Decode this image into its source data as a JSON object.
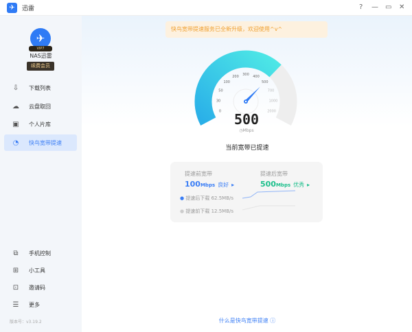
{
  "app": {
    "title": "迅雷",
    "logo_icon": "bird-logo-icon"
  },
  "window": {
    "help": "?",
    "minimize": "—",
    "maximize": "▭",
    "close": "✕"
  },
  "user": {
    "name": "NAS迅雷",
    "vip_badge": "VIP7",
    "renew_label": "续费会员"
  },
  "sidebar": {
    "items": [
      {
        "label": "下载列表",
        "icon": "download-icon",
        "glyph": "⇩"
      },
      {
        "label": "云盘取回",
        "icon": "cloud-icon",
        "glyph": "☁"
      },
      {
        "label": "个人片库",
        "icon": "film-icon",
        "glyph": "▣"
      },
      {
        "label": "快鸟宽带提速",
        "icon": "speedometer-icon",
        "glyph": "◔",
        "active": true
      }
    ],
    "bottom_items": [
      {
        "label": "手机控制",
        "icon": "devices-icon",
        "glyph": "⧉"
      },
      {
        "label": "小工具",
        "icon": "grid-icon",
        "glyph": "⊞"
      },
      {
        "label": "邀请码",
        "icon": "invite-icon",
        "glyph": "⊡"
      },
      {
        "label": "更多",
        "icon": "menu-icon",
        "glyph": "☰"
      }
    ],
    "version": "版本号：v3.19.2"
  },
  "banner": "快鸟宽带提速服务已全新升级，欢迎使用^v^",
  "gauge": {
    "ticks": [
      "0",
      "30",
      "50",
      "100",
      "200",
      "300",
      "400",
      "500",
      "700",
      "1000",
      "2000"
    ],
    "value": "500",
    "value_index": 7,
    "unit": "Mbps",
    "fill_color": "#3ad4e8",
    "track_color": "#eeeeee"
  },
  "status": "当前宽带已提速",
  "compare": {
    "before_label": "提速前宽带",
    "before_value": "100",
    "before_unit": "Mbps",
    "before_quality": "良好",
    "after_label": "提速后宽带",
    "after_value": "500",
    "after_unit": "Mbps",
    "after_quality": "优秀",
    "after_download": "提速后下载  62.5MB/s",
    "before_download": "提速前下载  12.5MB/s",
    "before_color": "#3b7ef5",
    "after_color": "#1dbf8c"
  },
  "help_link": "什么是快鸟宽带提速 ⓘ"
}
